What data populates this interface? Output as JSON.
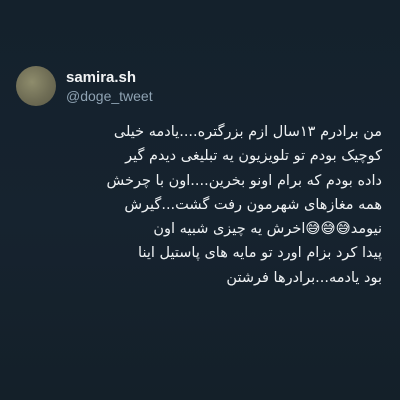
{
  "tweet": {
    "display_name": "samira.sh",
    "handle": "@doge_tweet",
    "avatar_icon": "avatar-image",
    "body_lines": [
      "من برادرم ۱۳سال ازم بزرگتره....یادمه خیلی",
      "کوچیک بودم تو تلویزیون یه تبلیغی دیدم گیر",
      "داده بودم که برام اونو بخرین....اون با چرخش",
      "همه مغازهای شهرمون رفت گشت...گیرش",
      "نیومد😅😅😅اخرش یه چیزی شبیه اون",
      "پیدا کرد بزام اورد تو مایه های پاستیل اینا",
      "بود یادمه...برادرها فرشتن"
    ]
  },
  "colors": {
    "background": "#15202b",
    "text_primary": "#eef1f3",
    "text_secondary": "#8fa3b3"
  }
}
